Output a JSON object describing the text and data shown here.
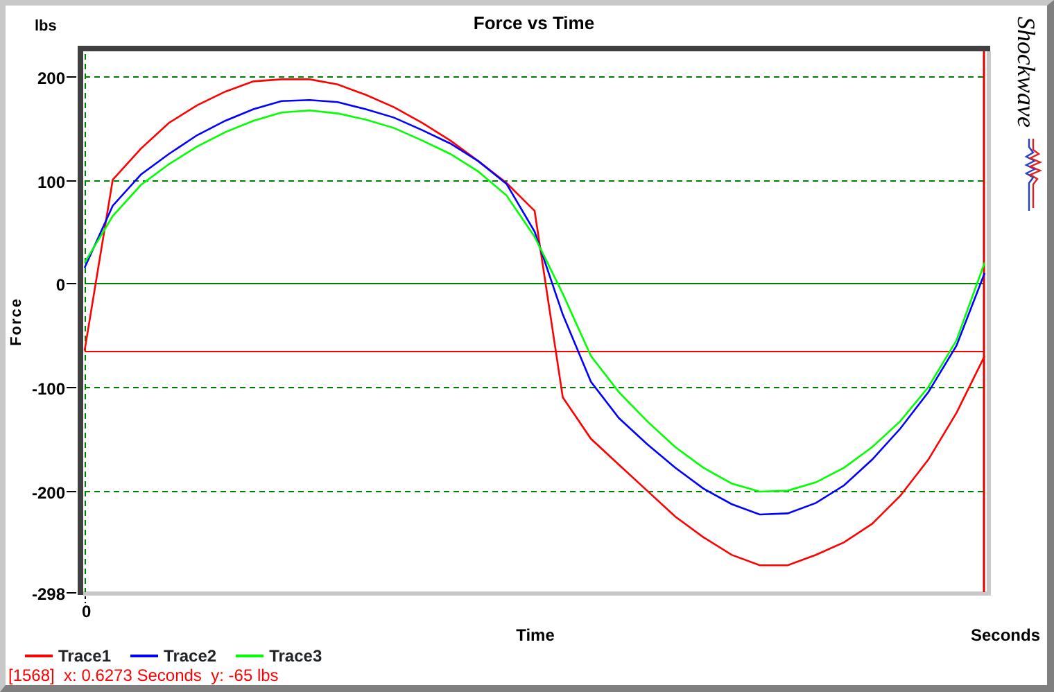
{
  "logo": {
    "text": "Shockwave"
  },
  "axes": {
    "y_unit": "lbs",
    "x_unit": "Seconds",
    "x_start": "0"
  },
  "chart_data": {
    "type": "line",
    "title": "Force vs Time",
    "xlabel": "Time",
    "ylabel": "Force",
    "ylim": [
      -298,
      224
    ],
    "yticks": [
      200,
      100,
      0,
      -100,
      -200,
      -298
    ],
    "grid": true,
    "series": [
      {
        "name": "Trace1",
        "color": "#ff0000",
        "values": [
          -65,
          100,
          130,
          155,
          172,
          185,
          195,
          197,
          197,
          192,
          182,
          170,
          155,
          138,
          118,
          97,
          70,
          -110,
          -150,
          -175,
          -200,
          -225,
          -245,
          -262,
          -272,
          -272,
          -262,
          -250,
          -232,
          -205,
          -170,
          -125,
          -70
        ]
      },
      {
        "name": "Trace2",
        "color": "#0000ff",
        "values": [
          15,
          75,
          105,
          125,
          143,
          157,
          168,
          176,
          177,
          175,
          168,
          160,
          148,
          135,
          118,
          96,
          50,
          -30,
          -95,
          -130,
          -155,
          -178,
          -198,
          -213,
          -223,
          -222,
          -212,
          -195,
          -170,
          -140,
          -105,
          -60,
          10
        ]
      },
      {
        "name": "Trace3",
        "color": "#00ff00",
        "values": [
          20,
          65,
          95,
          115,
          132,
          146,
          157,
          165,
          167,
          164,
          158,
          150,
          138,
          125,
          108,
          85,
          45,
          -10,
          -70,
          -105,
          -133,
          -158,
          -178,
          -193,
          -201,
          -200,
          -192,
          -178,
          -158,
          -133,
          -100,
          -55,
          20
        ]
      }
    ],
    "ref_lines": [
      {
        "axis": "y",
        "value": 0,
        "color": "#008000"
      },
      {
        "axis": "y",
        "value": -65,
        "color": "#ff0000"
      }
    ]
  },
  "status_bar": "[1568]  x: 0.6273 Seconds  y: -65 lbs"
}
